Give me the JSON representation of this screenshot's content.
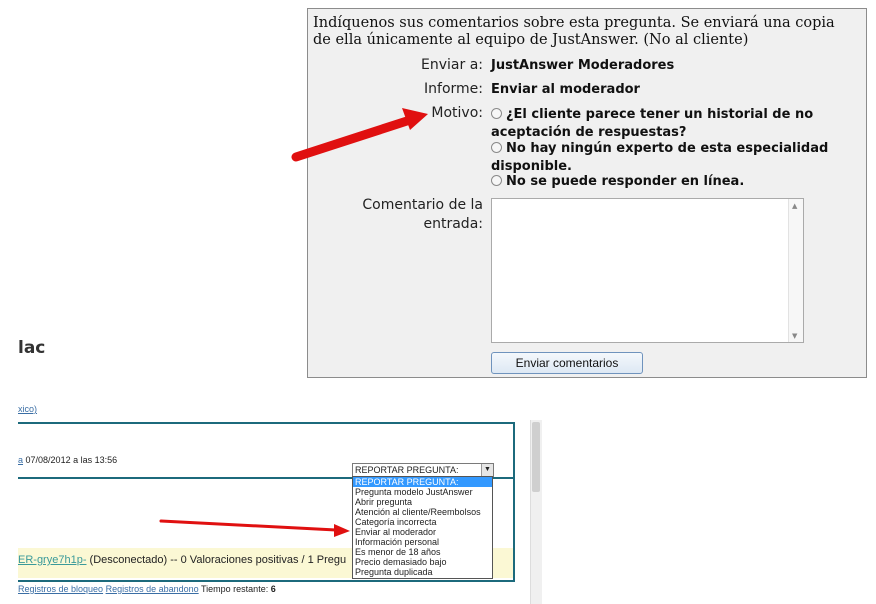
{
  "dialog": {
    "intro": "Indíquenos sus comentarios sobre esta pregunta. Se enviará una copia de ella únicamente al equipo de JustAnswer. (No al cliente)",
    "send_to_label": "Enviar a:",
    "send_to_value": "JustAnswer Moderadores",
    "report_label": "Informe:",
    "report_value": "Enviar al moderador",
    "reason_label": "Motivo:",
    "reasons": [
      "¿El cliente parece tener un historial de no aceptación de respuestas?",
      "No hay ningún experto de esta especialidad disponible.",
      "No se puede responder en línea."
    ],
    "comment_label": "Comentario de la entrada:",
    "comment_value": "",
    "submit_label": "Enviar comentarios"
  },
  "background": {
    "title_fragment": "lac",
    "top_link_fragment": "xico)",
    "date_link_fragment": "a",
    "date_text": "07/08/2012 a las 13:56",
    "user_link_fragment": "ER-grye7h1p-",
    "user_status": "(Desconectado) -- 0 Valoraciones positivas / 1 Pregu",
    "user_status_cut": "",
    "bottom_link_1": "Registros de bloqueo",
    "bottom_link_2": "Registros de abandono",
    "bottom_time_label": "Tiempo restante:",
    "bottom_time_value": "6"
  },
  "report_select": {
    "selected": "REPORTAR PREGUNTA:",
    "options": [
      "REPORTAR PREGUNTA:",
      "Pregunta modelo JustAnswer",
      "Abrir pregunta",
      "Atención al cliente/Reembolsos",
      "Categoría incorrecta",
      "Enviar al moderador",
      "Información personal",
      "Es menor de 18 años",
      "Precio demasiado bajo",
      "Pregunta duplicada"
    ]
  },
  "colors": {
    "arrow": "#e01010",
    "frame": "#1c6a7c",
    "dialog_bg": "#f0f0f0",
    "selected_option": "#3399ff"
  }
}
